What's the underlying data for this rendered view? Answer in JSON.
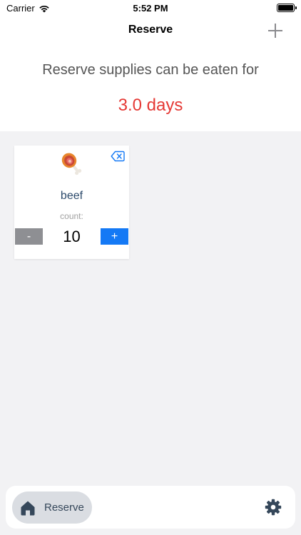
{
  "status_bar": {
    "carrier": "Carrier",
    "time": "5:52 PM",
    "wifi_icon": "wifi-icon",
    "battery_icon": "battery-icon"
  },
  "nav": {
    "title": "Reserve",
    "add_icon": "plus-icon"
  },
  "summary": {
    "headline": "Reserve supplies can be eaten for",
    "days": "3.0 days",
    "days_color": "#e53935"
  },
  "items": [
    {
      "name": "beef",
      "icon": "meat-on-bone-icon",
      "count_label": "count:",
      "count": "10",
      "minus_label": "-",
      "plus_label": "+",
      "remove_icon": "delete-backspace-icon"
    }
  ],
  "tab_bar": {
    "home_label": "Reserve",
    "home_icon": "home-icon",
    "settings_icon": "gear-icon"
  },
  "colors": {
    "accent": "#1479f5",
    "minus_button": "#8e8f93",
    "background": "#f2f2f4"
  }
}
